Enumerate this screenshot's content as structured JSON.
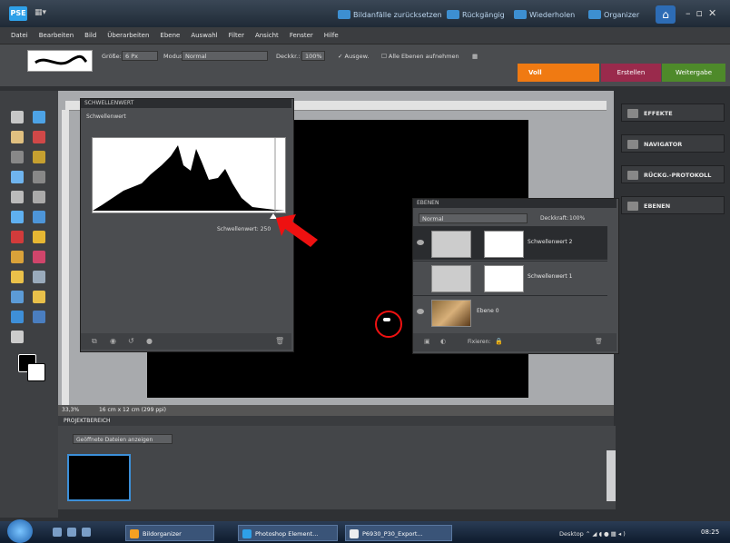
{
  "app": {
    "logo": "PSE",
    "title_buttons": [
      "Bildanfälle zurücksetzen",
      "Rückgängig",
      "Wiederholen",
      "Organizer"
    ]
  },
  "menu": [
    "Datei",
    "Bearbeiten",
    "Bild",
    "Überarbeiten",
    "Ebene",
    "Auswahl",
    "Filter",
    "Ansicht",
    "Fenster",
    "Hilfe"
  ],
  "options": {
    "size_label": "Größe:",
    "size_value": "6 Px",
    "mode_label": "Modus:",
    "mode_value": "Normal",
    "opacity_label": "Deckkr.:",
    "opacity_value": "100%",
    "airbrush_label": "Ausgew.",
    "all_layers_label": "Alle Ebenen aufnehmen"
  },
  "tabs": {
    "voll": "Voll",
    "erstellen": "Erstellen",
    "weitergabe": "Weitergabe"
  },
  "threshold": {
    "title": "SCHWELLENWERT",
    "subtitle": "Schwellenwert",
    "value_label": "Schwellenwert:",
    "value": "250"
  },
  "layers": {
    "title": "EBENEN",
    "mode": "Normal",
    "opacity_label": "Deckkraft:",
    "opacity_value": "100%",
    "rows": [
      {
        "name": "Schwellenwert 2"
      },
      {
        "name": "Schwellenwert 1"
      },
      {
        "name": "Ebene 0"
      }
    ],
    "lock_label": "Fixieren:"
  },
  "right_panel": [
    "EFFEKTE",
    "NAVIGATOR",
    "RÜCKG.-PROTOKOLL",
    "EBENEN"
  ],
  "status": {
    "zoom": "33,3%",
    "doc_info": "16 cm x 12 cm (299 ppi)"
  },
  "project_bin": {
    "title": "PROJEKTBEREICH",
    "show_label": "Geöffnete Dateien anzeigen"
  },
  "taskbar": {
    "tasks": [
      "Bildorganizer",
      "Photoshop Element...",
      "P6930_P30_Export..."
    ],
    "desktop": "Desktop",
    "clock": "08:25"
  }
}
